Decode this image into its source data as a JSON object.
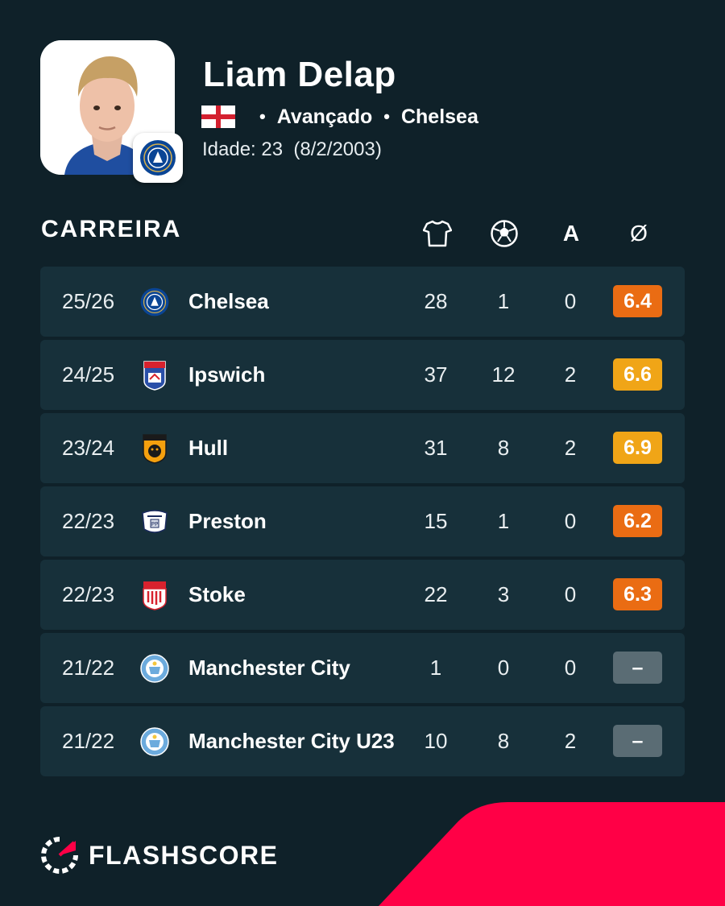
{
  "player": {
    "name": "Liam Delap",
    "country_flag": "england-flag",
    "position": "Avançado",
    "club": "Chelsea",
    "age_label": "Idade: 23  (8/2/2003)"
  },
  "career": {
    "title": "Carreira",
    "columns": {
      "appearances_icon": "shirt-icon",
      "goals_icon": "ball-icon",
      "assists": "A",
      "rating": "Ø"
    },
    "rows": [
      {
        "season": "25/26",
        "club": "Chelsea",
        "crest": "chelsea-crest-icon",
        "apps": "28",
        "goals": "1",
        "assists": "0",
        "rating": "6.4",
        "rating_color": "#ea6c13"
      },
      {
        "season": "24/25",
        "club": "Ipswich",
        "crest": "ipswich-crest-icon",
        "apps": "37",
        "goals": "12",
        "assists": "2",
        "rating": "6.6",
        "rating_color": "#f0a517"
      },
      {
        "season": "23/24",
        "club": "Hull",
        "crest": "hull-crest-icon",
        "apps": "31",
        "goals": "8",
        "assists": "2",
        "rating": "6.9",
        "rating_color": "#f0a517"
      },
      {
        "season": "22/23",
        "club": "Preston",
        "crest": "preston-crest-icon",
        "apps": "15",
        "goals": "1",
        "assists": "0",
        "rating": "6.2",
        "rating_color": "#ea6c13"
      },
      {
        "season": "22/23",
        "club": "Stoke",
        "crest": "stoke-crest-icon",
        "apps": "22",
        "goals": "3",
        "assists": "0",
        "rating": "6.3",
        "rating_color": "#ea6c13"
      },
      {
        "season": "21/22",
        "club": "Manchester City",
        "crest": "man-city-crest-icon",
        "apps": "1",
        "goals": "0",
        "assists": "0",
        "rating": "–",
        "rating_color": "#5a6c74"
      },
      {
        "season": "21/22",
        "club": "Manchester City U23",
        "crest": "man-city-crest-icon",
        "apps": "10",
        "goals": "8",
        "assists": "2",
        "rating": "–",
        "rating_color": "#5a6c74"
      }
    ]
  },
  "branding": {
    "logo_text": "FLASHSCORE",
    "accent_color": "#ff0046",
    "background_color": "#0f2129",
    "row_color": "#17303a"
  }
}
